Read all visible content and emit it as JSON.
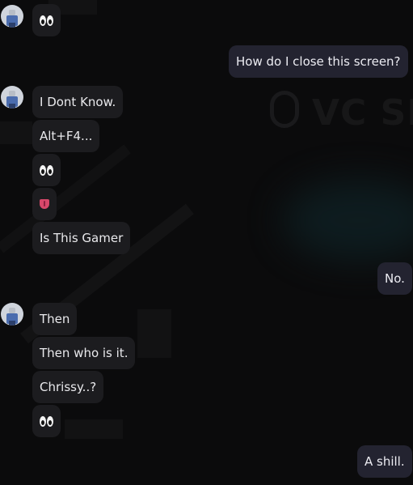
{
  "messages": [
    {
      "id": "m1",
      "type": "emoji",
      "emoji": "eyes-icon"
    },
    {
      "id": "m2",
      "text": "How do I close this screen?"
    },
    {
      "id": "m3",
      "text": "I Dont Know."
    },
    {
      "id": "m4",
      "text": "Alt+F4..."
    },
    {
      "id": "m5",
      "type": "emoji",
      "emoji": "eyes-icon"
    },
    {
      "id": "m6",
      "type": "emoji",
      "emoji": "tongue-icon"
    },
    {
      "id": "m7",
      "text": "Is This Gamer"
    },
    {
      "id": "m8",
      "text": "No."
    },
    {
      "id": "m9",
      "text": "Then"
    },
    {
      "id": "m10",
      "text": "Then who is it."
    },
    {
      "id": "m11",
      "text": "Chrissy..?"
    },
    {
      "id": "m12",
      "type": "emoji",
      "emoji": "eyes-icon"
    },
    {
      "id": "m13",
      "text": "A shill."
    }
  ],
  "background": {
    "watermark_text": "VC SEI"
  },
  "colors": {
    "page_bg": "#0b0b0c",
    "incoming_bubble": "#1c1c1f",
    "outgoing_bubble": "#232330"
  }
}
